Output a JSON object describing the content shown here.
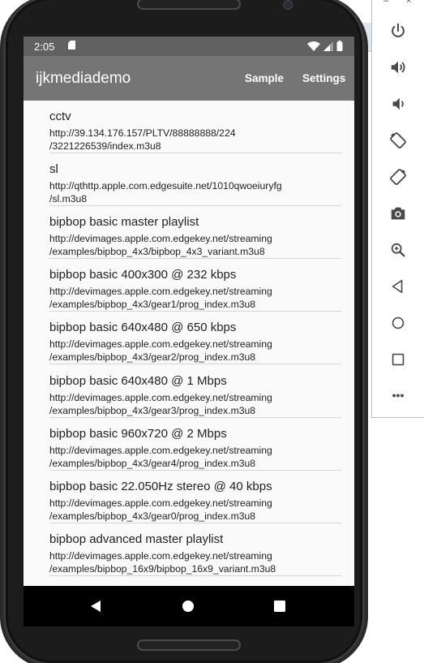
{
  "status": {
    "time": "2:05"
  },
  "appbar": {
    "title": "ijkmediademo",
    "actions": [
      "Sample",
      "Settings"
    ]
  },
  "list": [
    {
      "title": "cctv",
      "url": "http://39.134.176.157/PLTV/88888888/224\n/3221226539/index.m3u8"
    },
    {
      "title": "sl",
      "url": "http://qthttp.apple.com.edgesuite.net/1010qwoeiuryfg\n/sl.m3u8"
    },
    {
      "title": "bipbop basic master playlist",
      "url": "http://devimages.apple.com.edgekey.net/streaming\n/examples/bipbop_4x3/bipbop_4x3_variant.m3u8"
    },
    {
      "title": "bipbop basic 400x300 @ 232 kbps",
      "url": "http://devimages.apple.com.edgekey.net/streaming\n/examples/bipbop_4x3/gear1/prog_index.m3u8"
    },
    {
      "title": "bipbop basic 640x480 @ 650 kbps",
      "url": "http://devimages.apple.com.edgekey.net/streaming\n/examples/bipbop_4x3/gear2/prog_index.m3u8"
    },
    {
      "title": "bipbop basic 640x480 @ 1 Mbps",
      "url": "http://devimages.apple.com.edgekey.net/streaming\n/examples/bipbop_4x3/gear3/prog_index.m3u8"
    },
    {
      "title": "bipbop basic 960x720 @ 2 Mbps",
      "url": "http://devimages.apple.com.edgekey.net/streaming\n/examples/bipbop_4x3/gear4/prog_index.m3u8"
    },
    {
      "title": "bipbop basic 22.050Hz stereo @ 40 kbps",
      "url": "http://devimages.apple.com.edgekey.net/streaming\n/examples/bipbop_4x3/gear0/prog_index.m3u8"
    },
    {
      "title": "bipbop advanced master playlist",
      "url": "http://devimages.apple.com.edgekey.net/streaming\n/examples/bipbop_16x9/bipbop_16x9_variant.m3u8"
    }
  ],
  "emulator_toolbar": {
    "window_controls": [
      "–",
      "×"
    ],
    "buttons": [
      "power-icon",
      "volume-up-icon",
      "volume-down-icon",
      "rotate-left-icon",
      "rotate-right-icon",
      "camera-icon",
      "zoom-icon",
      "back-icon",
      "home-icon",
      "overview-icon",
      "more-icon"
    ],
    "more_label": "•••"
  },
  "colors": {
    "appbar": "#757575",
    "statusbar": "#616161",
    "list_bg": "#fafafa",
    "divider": "#d6d6d6"
  }
}
